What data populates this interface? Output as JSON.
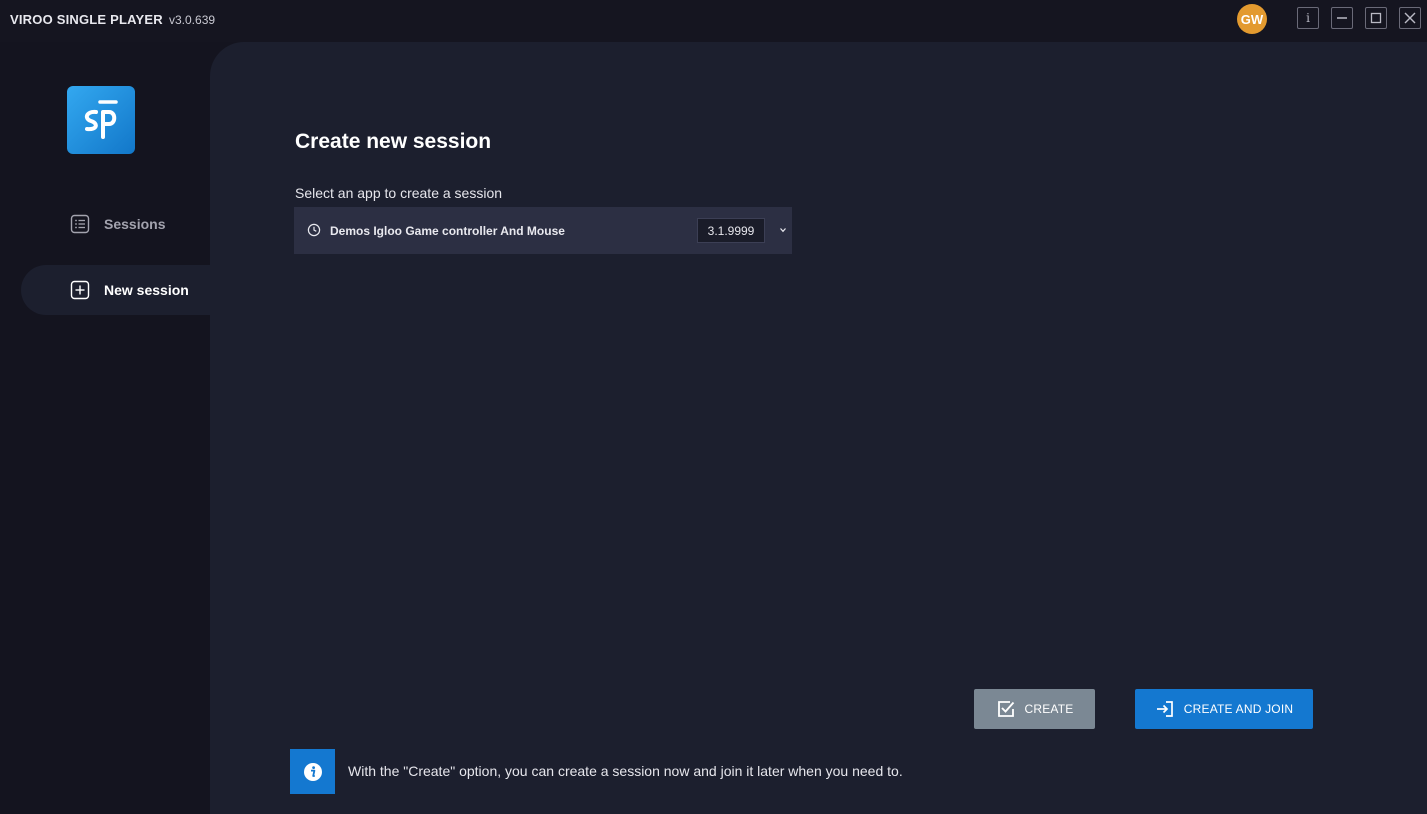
{
  "titlebar": {
    "app_title": "VIROO SINGLE PLAYER",
    "version": "v3.0.639",
    "avatar_initials": "GW",
    "avatar_color": "#e39a2f",
    "info_glyph": "i"
  },
  "sidebar": {
    "logo_icon": "viroo-sp-logo-icon",
    "items": [
      {
        "label": "Sessions",
        "icon": "list-icon",
        "active": false
      },
      {
        "label": "New session",
        "icon": "plus-square-icon",
        "active": true
      }
    ]
  },
  "main": {
    "title": "Create new session",
    "select_label": "Select an app to create a session",
    "app_select": {
      "app_name": "Demos Igloo Game controller And Mouse",
      "version": "3.1.9999"
    },
    "buttons": {
      "create_label": "CREATE",
      "create_and_join_label": "CREATE AND JOIN"
    },
    "info_text": "With the \"Create\" option, you can create a session now and join it later when you need to."
  },
  "colors": {
    "accent": "#1478d0",
    "create_button": "#7b8894",
    "panel_bg": "#1c1f2e",
    "select_bg": "#2c2f43"
  }
}
